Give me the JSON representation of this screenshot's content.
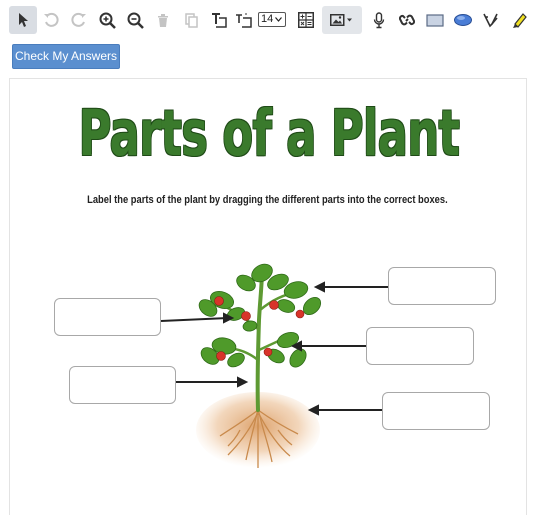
{
  "toolbar": {
    "tools": [
      {
        "name": "pointer-icon",
        "state": "active"
      },
      {
        "name": "undo-icon",
        "state": "disabled"
      },
      {
        "name": "redo-icon",
        "state": "disabled"
      },
      {
        "name": "zoom-in-icon",
        "state": "normal"
      },
      {
        "name": "zoom-out-icon",
        "state": "normal"
      },
      {
        "name": "trash-icon",
        "state": "disabled"
      },
      {
        "name": "copy-icon",
        "state": "disabled"
      },
      {
        "name": "text-box-icon",
        "state": "normal"
      },
      {
        "name": "text-size-icon",
        "state": "normal"
      },
      {
        "name": "calculator-icon",
        "state": "normal"
      },
      {
        "name": "image-icon",
        "state": "normal"
      },
      {
        "name": "microphone-icon",
        "state": "normal"
      },
      {
        "name": "link-icon",
        "state": "normal"
      },
      {
        "name": "rectangle-icon",
        "state": "normal"
      },
      {
        "name": "ellipse-icon",
        "state": "normal"
      },
      {
        "name": "pen-icon",
        "state": "normal"
      },
      {
        "name": "highlighter-icon",
        "state": "normal"
      }
    ],
    "font_size": "14"
  },
  "check_button_label": "Check My Answers",
  "worksheet": {
    "title": "Parts of a Plant",
    "instructions": "Label the parts of the plant by dragging the different parts into the correct boxes.",
    "label_box_count": 5
  },
  "colors": {
    "title_green": "#3a7a2c",
    "button_blue": "#5b8fcf",
    "active_tool_bg": "#d9dde3",
    "highlighter_yellow": "#f0e020",
    "ellipse_blue": "#4a7dd6"
  }
}
